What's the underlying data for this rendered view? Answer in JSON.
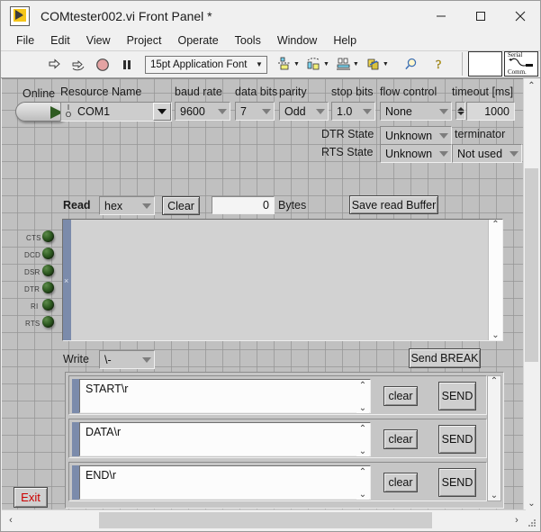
{
  "window": {
    "title": "COMtester002.vi Front Panel *",
    "icon_name": "labview-vi-icon",
    "minimize": "─",
    "maximize": "□",
    "close": "✕"
  },
  "menu": {
    "items": [
      "File",
      "Edit",
      "View",
      "Project",
      "Operate",
      "Tools",
      "Window",
      "Help"
    ]
  },
  "toolbar": {
    "run_icon": "run-arrow-icon",
    "run_continuous_icon": "run-continuously-icon",
    "abort_icon": "abort-execution-icon",
    "pause_icon": "pause-icon",
    "font_selector": "15pt Application Font",
    "align_icon": "align-objects-icon",
    "distribute_icon": "distribute-objects-icon",
    "resize_icon": "resize-objects-icon",
    "reorder_icon": "reorder-objects-icon",
    "search_icon": "search-icon",
    "help_icon": "help-icon",
    "vi_icon_top": "Serial",
    "vi_icon_bottom": "Comm."
  },
  "panel": {
    "online": {
      "label": "Online",
      "state": "on"
    },
    "resource_name": {
      "label": "Resource Name",
      "value": "COM1",
      "io_glyph_top": "I",
      "io_glyph_bottom": "O"
    },
    "baud_rate": {
      "label": "baud rate",
      "value": "9600"
    },
    "data_bits": {
      "label": "data bits",
      "value": "7"
    },
    "parity": {
      "label": "parity",
      "value": "Odd"
    },
    "stop_bits": {
      "label": "stop bits",
      "value": "1.0"
    },
    "flow_control": {
      "label": "flow control",
      "value": "None"
    },
    "timeout": {
      "label": "timeout [ms]",
      "value": "1000"
    },
    "dtr_state": {
      "label": "DTR State",
      "value": "Unknown"
    },
    "rts_state": {
      "label": "RTS State",
      "value": "Unknown"
    },
    "terminator": {
      "label": "terminator",
      "value": "Not used"
    },
    "read": {
      "label": "Read",
      "format": "hex",
      "clear_label": "Clear",
      "bytes_count": "0",
      "bytes_label": "Bytes",
      "save_label": "Save read Buffer",
      "buffer_text": ""
    },
    "status_leds": [
      {
        "label": "CTS",
        "state": "off"
      },
      {
        "label": "DCD",
        "state": "off"
      },
      {
        "label": "DSR",
        "state": "off"
      },
      {
        "label": "DTR",
        "state": "off"
      },
      {
        "label": "RI",
        "state": "off"
      },
      {
        "label": "RTS",
        "state": "off"
      }
    ],
    "write": {
      "label": "Write",
      "format": "\\-",
      "send_break_label": "Send BREAK",
      "rows": [
        {
          "text": "START\\r",
          "clear_label": "clear",
          "send_label": "SEND"
        },
        {
          "text": "DATA\\r",
          "clear_label": "clear",
          "send_label": "SEND"
        },
        {
          "text": "END\\r",
          "clear_label": "clear",
          "send_label": "SEND"
        }
      ]
    },
    "exit_button": "Exit"
  },
  "scrollbars": {
    "v_up": "⌃",
    "v_down": "⌄",
    "h_left": "‹",
    "h_right": "›"
  }
}
